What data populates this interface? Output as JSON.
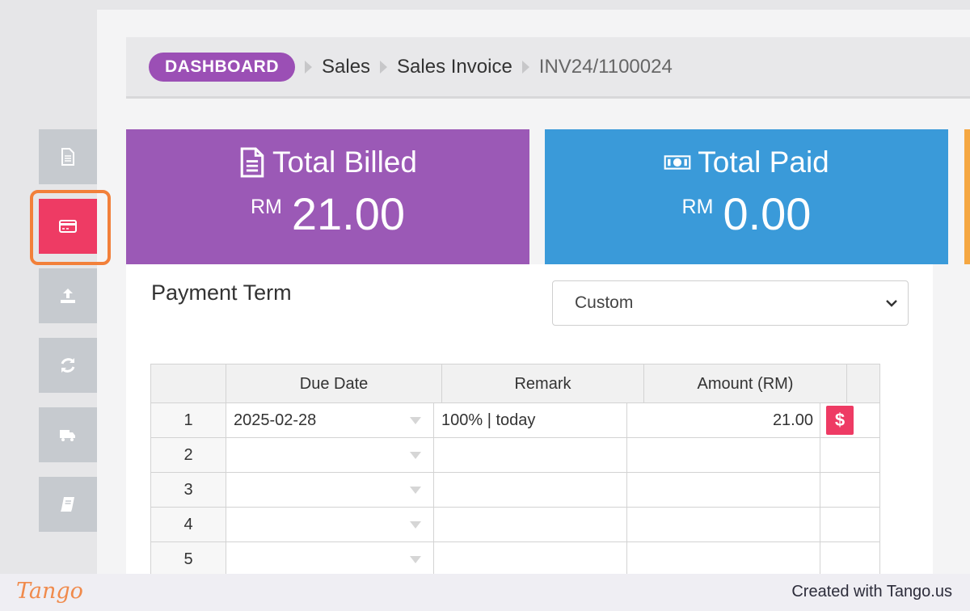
{
  "breadcrumb": {
    "dashboard": "DASHBOARD",
    "items": [
      "Sales",
      "Sales Invoice",
      "INV24/1100024"
    ]
  },
  "sidebar": {
    "tabs": [
      {
        "name": "document-icon",
        "active": false
      },
      {
        "name": "credit-card-icon",
        "active": true
      },
      {
        "name": "upload-icon",
        "active": false
      },
      {
        "name": "sync-icon",
        "active": false
      },
      {
        "name": "truck-icon",
        "active": false
      },
      {
        "name": "book-icon",
        "active": false
      }
    ]
  },
  "cards": {
    "billed": {
      "title": "Total Billed",
      "currency": "RM",
      "value": "21.00",
      "color": "#9b59b6"
    },
    "paid": {
      "title": "Total Paid",
      "currency": "RM",
      "value": "0.00",
      "color": "#3a9ad9"
    }
  },
  "payment_term": {
    "label": "Payment Term",
    "selected": "Custom"
  },
  "table": {
    "headers": {
      "due_date": "Due Date",
      "remark": "Remark",
      "amount": "Amount (RM)"
    },
    "rows": [
      {
        "no": "1",
        "due_date": "2025-02-28",
        "remark": "100% |  today",
        "amount": "21.00",
        "action": "$"
      },
      {
        "no": "2",
        "due_date": "",
        "remark": "",
        "amount": ""
      },
      {
        "no": "3",
        "due_date": "",
        "remark": "",
        "amount": ""
      },
      {
        "no": "4",
        "due_date": "",
        "remark": "",
        "amount": ""
      },
      {
        "no": "5",
        "due_date": "",
        "remark": "",
        "amount": ""
      }
    ]
  },
  "footer": {
    "logo": "Tango",
    "credit": "Created with Tango.us"
  },
  "colors": {
    "accent": "#ee3b64",
    "highlight": "#f2803a",
    "dashboard": "#9b4fb5"
  }
}
